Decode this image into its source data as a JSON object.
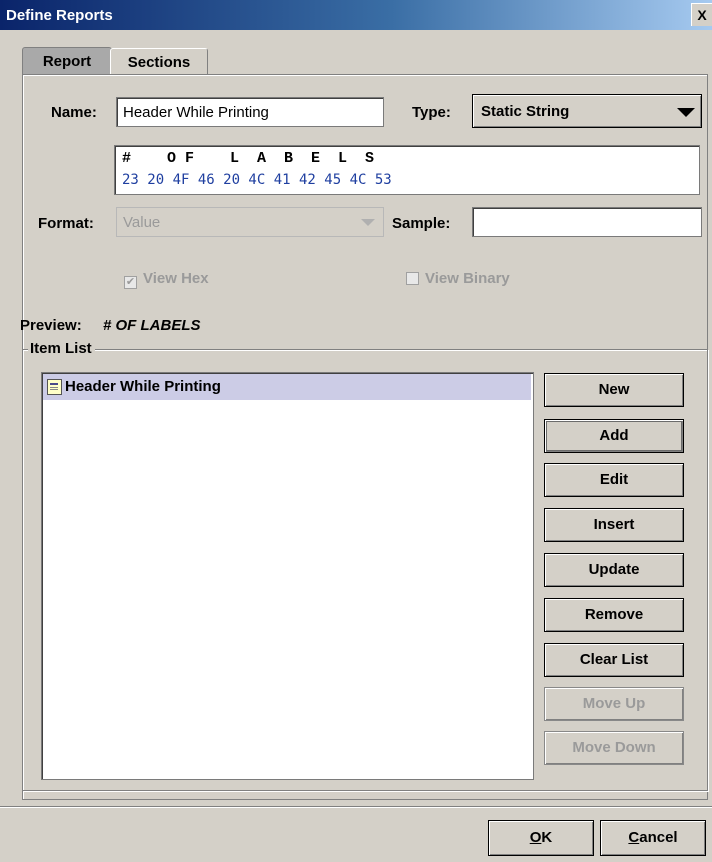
{
  "window": {
    "title": "Define Reports",
    "close_label": "X"
  },
  "tabs": [
    {
      "label": "Report"
    },
    {
      "label": "Sections"
    }
  ],
  "form": {
    "name_label": "Name:",
    "name_value": "Header While Printing",
    "type_label": "Type:",
    "type_value": "Static String",
    "hex_chars": "#    O F    L  A  B  E  L  S",
    "hex_codes": "23 20 4F 46 20 4C 41 42 45 4C 53",
    "format_label": "Format:",
    "format_value": "Value",
    "sample_label": "Sample:",
    "sample_value": "",
    "view_hex_label": "View Hex",
    "view_hex_checked": true,
    "view_binary_label": "View Binary",
    "view_binary_checked": false,
    "preview_label": "Preview:",
    "preview_value": "# OF LABELS"
  },
  "item_list": {
    "title": "Item List",
    "items": [
      {
        "label": "Header While Printing",
        "icon": "report-item-icon",
        "selected": true
      }
    ]
  },
  "buttons": {
    "new": "New",
    "add": "Add",
    "edit": "Edit",
    "insert": "Insert",
    "update": "Update",
    "remove": "Remove",
    "clear_list": "Clear List",
    "move_up": "Move Up",
    "move_down": "Move Down"
  },
  "dialog_buttons": {
    "ok_mnemonic": "O",
    "ok_rest": "K",
    "cancel_mnemonic": "C",
    "cancel_rest": "ancel"
  },
  "colors": {
    "titlebar_start": "#0a246a",
    "selection": "#cccce6",
    "hex_code_text": "#1f3fa0",
    "disabled_text": "#9a9a9a"
  }
}
